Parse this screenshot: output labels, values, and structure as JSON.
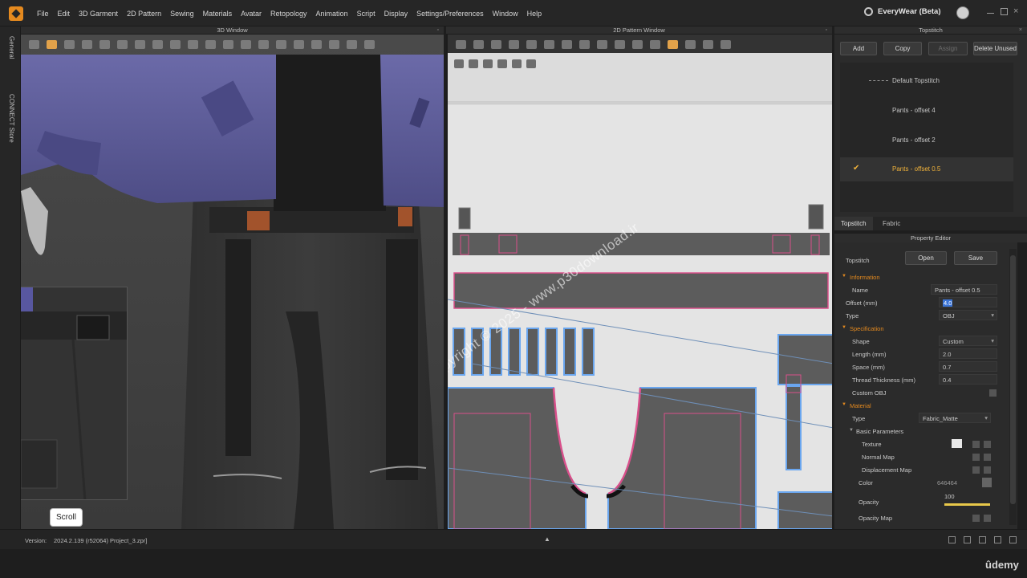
{
  "menu": [
    "File",
    "Edit",
    "3D Garment",
    "2D Pattern",
    "Sewing",
    "Materials",
    "Avatar",
    "Retopology",
    "Animation",
    "Script",
    "Display",
    "Settings/Preferences",
    "Window",
    "Help"
  ],
  "brand": "EveryWear (Beta)",
  "side_tabs": [
    "General",
    "CONNECT Store"
  ],
  "panels": {
    "window_3d": "3D Window",
    "window_2d": "2D Pattern Window",
    "topstitch": "Topstitch",
    "property_editor": "Property Editor"
  },
  "watermark": "Copyright © 2025 - www.p30download.ir",
  "tooltip": "Scroll",
  "topstitch_buttons": {
    "add": "Add",
    "copy": "Copy",
    "assign": "Assign",
    "delete_unused": "Delete Unused"
  },
  "topstitch_list": [
    {
      "label": "Default Topstitch",
      "selected": false,
      "dashed": true
    },
    {
      "label": "Pants - offset 4",
      "selected": false,
      "dashed": false
    },
    {
      "label": "Pants - offset 2",
      "selected": false,
      "dashed": false
    },
    {
      "label": "Pants - offset 0.5",
      "selected": true,
      "dashed": false
    }
  ],
  "lower_tabs": [
    "Topstitch",
    "Fabric"
  ],
  "property": {
    "object": "Topstitch",
    "open": "Open",
    "save": "Save",
    "information": "Information",
    "name_label": "Name",
    "name_value": "Pants - offset 0.5",
    "offset_label": "Offset (mm)",
    "offset_value": "4.0",
    "type_label": "Type",
    "type_value": "OBJ",
    "specification": "Specification",
    "shape_label": "Shape",
    "shape_value": "Custom",
    "length_label": "Length (mm)",
    "length_value": "2.0",
    "space_label": "Space (mm)",
    "space_value": "0.7",
    "thread_label": "Thread Thickness (mm)",
    "thread_value": "0.4",
    "custom_obj_label": "Custom OBJ",
    "material": "Material",
    "mat_type_label": "Type",
    "mat_type_value": "Fabric_Matte",
    "basic_params": "Basic Parameters",
    "texture_label": "Texture",
    "normal_map_label": "Normal Map",
    "displacement_label": "Displacement Map",
    "color_label": "Color",
    "color_value": "646464",
    "opacity_label": "Opacity",
    "opacity_value": "100",
    "opacity_fraction": 1.0,
    "opacity_map_label": "Opacity Map"
  },
  "status": {
    "version_label": "Version:",
    "version_value": "2024.2.139 (r52064)   Project_3.zpr]"
  },
  "footer_brand": "ûdemy",
  "colors": {
    "accent": "#e58a1f",
    "selection": "#f0b23a",
    "jacket": "#5f5e9a",
    "pattern_piece": "#5c5c5c",
    "seam_pink": "#d94f8a",
    "seam_blue": "#6aa6ef"
  }
}
